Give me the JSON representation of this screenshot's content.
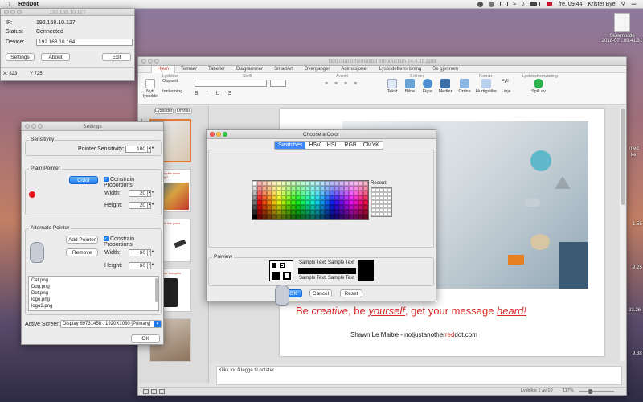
{
  "menubar": {
    "app_name": "RedDot",
    "status_items": [
      "fre. 09:44",
      "Krister Bye"
    ]
  },
  "desktop": {
    "file_label": "Skjermbilde",
    "file_label2": "2018-07...09.41.31",
    "edge_labels": [
      "med",
      "ke",
      "1.55",
      "9.25",
      "33.26",
      "9.38"
    ]
  },
  "reddot": {
    "title": "192.168.10.127",
    "ip_label": "IP:",
    "ip_value": "192.168.10.127",
    "status_label": "Status:",
    "status_value": "Connected",
    "device_label": "Device:",
    "device_value": "192.168.10.164",
    "settings_btn": "Settings",
    "about_btn": "About",
    "exit_btn": "Exit",
    "x_label": "X: 823",
    "y_label": "Y 725"
  },
  "settings": {
    "title": "Settings",
    "sensitivity_title": "Sensitivity",
    "pointer_sens_label": "Pointer Sensitivity:",
    "pointer_sens_value": "100",
    "plain_title": "Plain Pointer",
    "color_btn": "Color",
    "constrain_label": "Constrain Proportions",
    "width_label": "Width:",
    "width_value": "20",
    "height_label": "Height:",
    "height_value": "20",
    "alt_title": "Alternate Pointer",
    "add_btn": "Add Pointer",
    "remove_btn": "Remove",
    "alt_constrain_label": "Constrain Proportions",
    "alt_width_label": "Width:",
    "alt_width_value": "60",
    "alt_height_label": "Height:",
    "alt_height_value": "60",
    "files": [
      "Cat.png",
      "Dog.png",
      "Dot.png",
      "logo.png",
      "logo2.png"
    ],
    "active_screen_label": "Active Screen:",
    "active_screen_value": "Display 69731458 : 1920X1080 [Primary]",
    "ok_btn": "OK",
    "plain_color": "#e8141e"
  },
  "ppt": {
    "title": "Notjustanotherreddot Introduction 24.4.18.pptx",
    "tabs": [
      "Hjem",
      "Temaer",
      "Tabeller",
      "Diagrammer",
      "SmartArt",
      "Overganger",
      "Animasjoner",
      "Lysbildefremvisning",
      "Se gjennom"
    ],
    "group_labels": [
      "Lysbilder",
      "Skrift",
      "Avsnitt",
      "Sett inn",
      "Format",
      "Lysbildefremvisning"
    ],
    "ribbon_items": [
      "Nytt lysbilde",
      "Oppsett",
      "Innledning",
      "Tekst",
      "Bilde",
      "Figur",
      "Medier",
      "Ordne",
      "Hurtigstiler",
      "Fyll",
      "Linje",
      "Spill av"
    ],
    "pane_tabs": [
      "Lysbilder",
      "Omriss"
    ],
    "slide_numbers": [
      "1",
      "2",
      "3",
      "4",
      "5"
    ],
    "thumb_texts": [
      "Communicate more effectively?",
      "Straight to the point",
      "Share your thoughts",
      ""
    ],
    "slide_tagline_parts": [
      "Be ",
      "creative",
      ", be ",
      "yourself",
      ", get your message ",
      "heard!"
    ],
    "slide_author": "Shawn Le Maitre  - notjustanother",
    "slide_author_red": "red",
    "slide_author_end": "dot.com",
    "notes": "Klikk for å legge til notater",
    "status_slide": "Lysbilde 1 av 10",
    "zoom": "117%",
    "accent": "#c0392b"
  },
  "color_dialog": {
    "title": "Choose a Color",
    "tabs": [
      "Swatches",
      "HSV",
      "HSL",
      "RGB",
      "CMYK"
    ],
    "recent_label": "Recent:",
    "preview_label": "Preview",
    "sample_texts": [
      "Sample Text",
      "Sample Text",
      "Sample Text",
      "Sample Text"
    ],
    "ok_btn": "OK",
    "cancel_btn": "Cancel",
    "reset_btn": "Reset"
  }
}
